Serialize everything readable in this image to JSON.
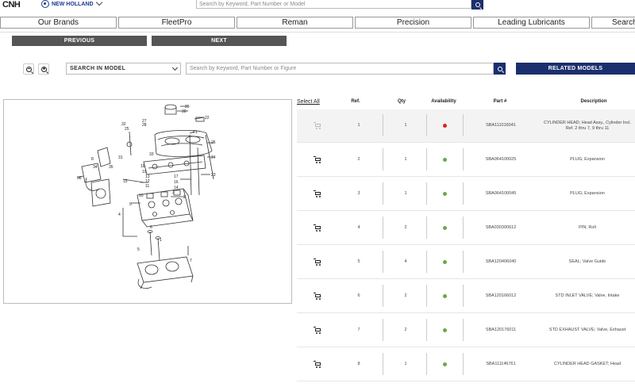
{
  "header": {
    "logo_cnh": "CNH",
    "brand_name": "NEW HOLLAND",
    "search_placeholder": "Search by Keyword, Part Number or Model"
  },
  "nav": {
    "items": [
      {
        "label": "Our Brands"
      },
      {
        "label": "FleetPro"
      },
      {
        "label": "Reman"
      },
      {
        "label": "Precision"
      },
      {
        "label": "Leading Lubricants"
      },
      {
        "label": "Search"
      }
    ]
  },
  "pager": {
    "previous": "PREVIOUS",
    "next": "NEXT"
  },
  "toolbar": {
    "search_scope": "SEARCH IN MODEL",
    "search_placeholder": "Search by Keyword, Part Number or Figure",
    "related_models": "RELATED MODELS"
  },
  "colors": {
    "brand_navy": "#1b2f6e",
    "button_gray": "#555555",
    "available_green": "#6aa84f",
    "unavailable_red": "#e02020"
  },
  "diagram": {
    "callouts": [
      "29",
      "30",
      "22",
      "27",
      "28",
      "32",
      "21",
      "25",
      "31",
      "26",
      "24",
      "23",
      "18",
      "19",
      "17",
      "16",
      "15",
      "14",
      "13",
      "12",
      "11",
      "10",
      "9",
      "3",
      "2",
      "4",
      "1",
      "6",
      "5",
      "7",
      "8",
      "34",
      "35",
      "36",
      "33",
      "20"
    ]
  },
  "table": {
    "select_all": "Select All",
    "headers": {
      "ref": "Ref.",
      "qty": "Qty",
      "availability": "Availability",
      "part": "Part #",
      "description": "Description"
    },
    "rows": [
      {
        "ref": "1",
        "qty": "1",
        "availability": "unavailable",
        "part": "SBA111016041",
        "description": "CYLINDER HEAD; Head Assy., Cylinder Incl. Ref. 2 thru 7, 9 thru 11",
        "cart_enabled": false
      },
      {
        "ref": "2",
        "qty": "1",
        "availability": "available",
        "part": "SBA064100025",
        "description": "PLUG; Expansion",
        "cart_enabled": true
      },
      {
        "ref": "3",
        "qty": "1",
        "availability": "available",
        "part": "SBA064100045",
        "description": "PLUG; Expansion",
        "cart_enabled": true
      },
      {
        "ref": "4",
        "qty": "2",
        "availability": "available",
        "part": "SBA030300612",
        "description": "PIN; Roll",
        "cart_enabled": true
      },
      {
        "ref": "5",
        "qty": "4",
        "availability": "available",
        "part": "SBA120406040",
        "description": "SEAL; Valve Guide",
        "cart_enabled": true
      },
      {
        "ref": "6",
        "qty": "2",
        "availability": "available",
        "part": "SBA120166012",
        "description": "STD INLET VALVE; Valve, Intake",
        "cart_enabled": true
      },
      {
        "ref": "7",
        "qty": "2",
        "availability": "available",
        "part": "SBA120176011",
        "description": "STD EXHAUST VALVE; Valve, Exhaust",
        "cart_enabled": true
      },
      {
        "ref": "8",
        "qty": "1",
        "availability": "available",
        "part": "SBA111146761",
        "description": "CYLINDER HEAD GASKET; Head",
        "cart_enabled": true
      }
    ]
  }
}
